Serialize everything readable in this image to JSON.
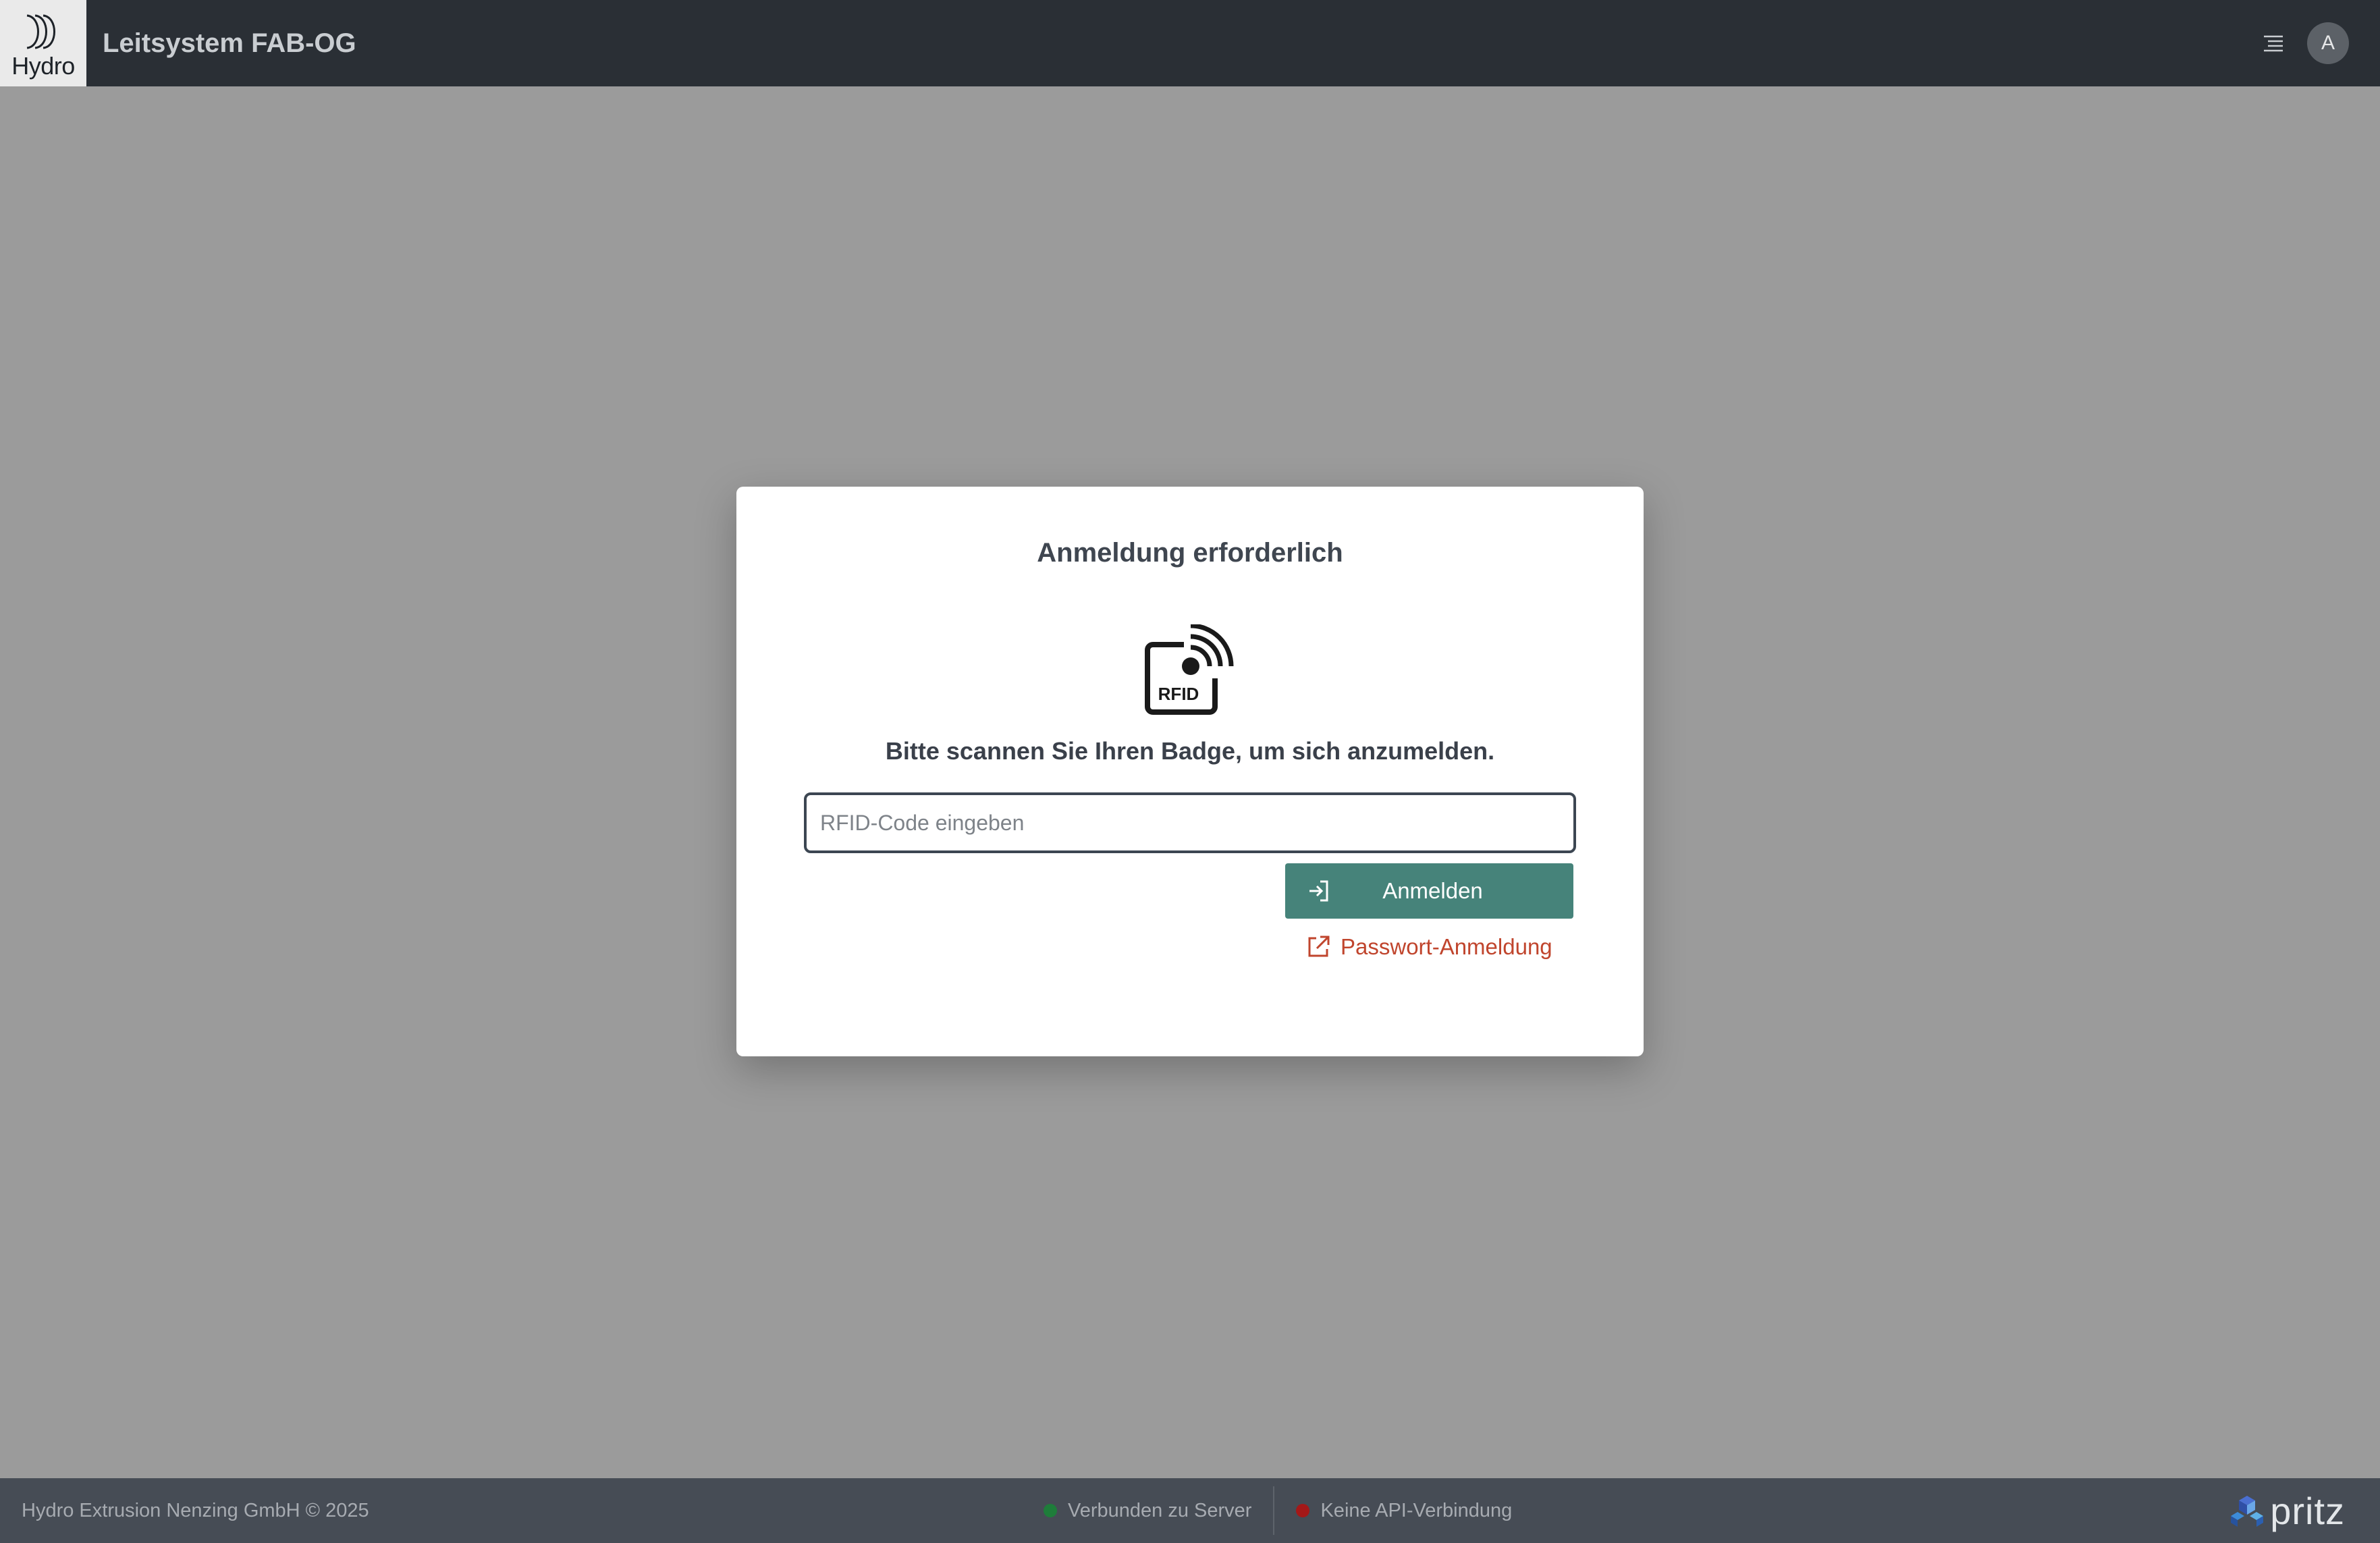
{
  "header": {
    "logo_text": "Hydro",
    "app_title": "Leitsystem FAB-OG",
    "menu_icon": "menu-lines-icon",
    "avatar_initial": "A"
  },
  "modal": {
    "title": "Anmeldung erforderlich",
    "icon": "rfid-icon",
    "icon_label": "RFID",
    "instruction": "Bitte scannen Sie Ihren Badge, um sich anzumelden.",
    "input": {
      "placeholder": "RFID-Code eingeben",
      "value": ""
    },
    "login_button": {
      "label": "Anmelden",
      "icon": "login-arrow-icon"
    },
    "password_link": {
      "label": "Passwort-Anmeldung",
      "icon": "external-link-icon"
    }
  },
  "footer": {
    "copyright": "Hydro Extrusion Nenzing GmbH © 2025",
    "status": [
      {
        "label": "Verbunden zu Server",
        "color": "#1e7d3a"
      },
      {
        "label": "Keine API-Verbindung",
        "color": "#a41818"
      }
    ],
    "brand": "pritz"
  },
  "colors": {
    "header_bg": "#2a2f35",
    "overlay_bg": "#9b9b9b",
    "primary_button": "#46837a",
    "link": "#c0452d",
    "footer_bg": "#464c55"
  }
}
